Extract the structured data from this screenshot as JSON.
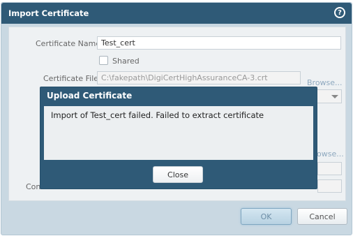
{
  "dialog": {
    "title": "Import Certificate",
    "help_icon": "?",
    "fields": {
      "certificate_name_label": "Certificate Name",
      "certificate_name_value": "Test_cert",
      "shared_label": "Shared",
      "certificate_file_label": "Certificate File",
      "certificate_file_value": "C:\\fakepath\\DigiCertHighAssuranceCA-3.crt",
      "browse_label": "Browse...",
      "browse_label_partial": "owse...",
      "partial_label_left": "Con"
    },
    "buttons": {
      "ok": "OK",
      "cancel": "Cancel"
    }
  },
  "modal": {
    "title": "Upload Certificate",
    "message": "Import of Test_cert failed. Failed to extract certificate",
    "close": "Close"
  }
}
